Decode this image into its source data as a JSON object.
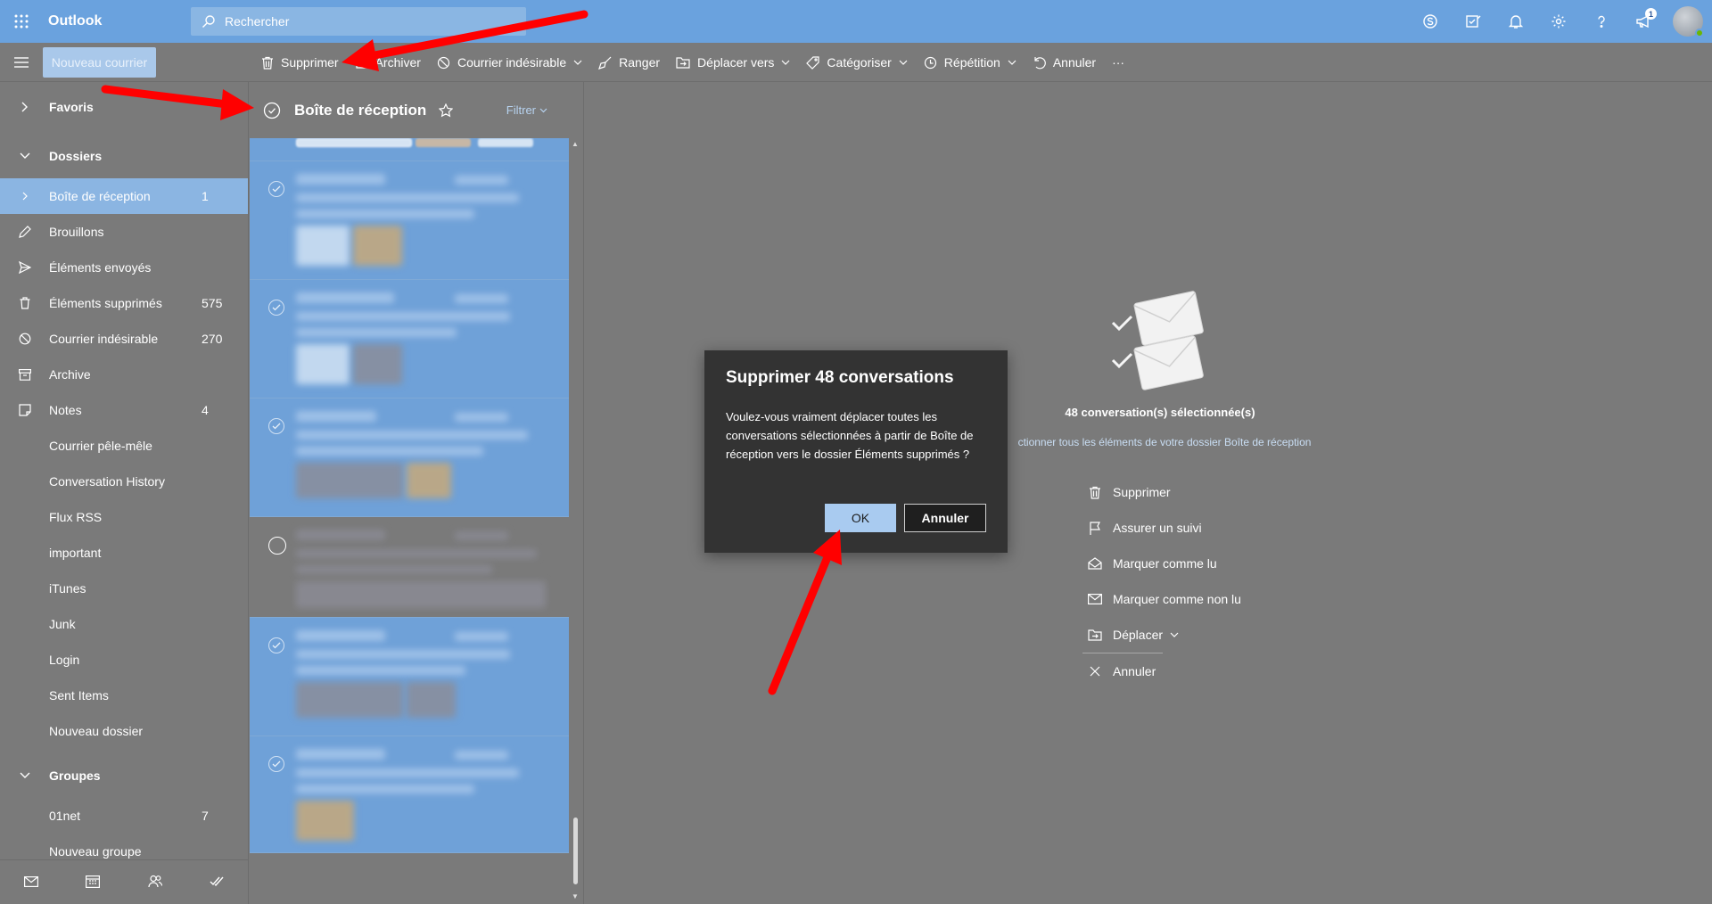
{
  "topbar": {
    "app_name": "Outlook",
    "search_placeholder": "Rechercher",
    "notification_count": "1"
  },
  "toolbar": {
    "new_mail": "Nouveau courrier",
    "commands": [
      {
        "label": "Supprimer",
        "icon": "trash-icon"
      },
      {
        "label": "Archiver",
        "icon": "archive-icon"
      },
      {
        "label": "Courrier indésirable",
        "icon": "block-icon"
      },
      {
        "label": "Ranger",
        "icon": "broom-icon"
      },
      {
        "label": "Déplacer vers",
        "icon": "move-folder-icon"
      },
      {
        "label": "Catégoriser",
        "icon": "tag-icon"
      },
      {
        "label": "Répétition",
        "icon": "clock-icon"
      },
      {
        "label": "Annuler",
        "icon": "undo-icon"
      }
    ],
    "more": "···"
  },
  "leftnav": {
    "favorites": "Favoris",
    "folders": "Dossiers",
    "items": [
      {
        "label": "Boîte de réception",
        "count": "1"
      },
      {
        "label": "Brouillons",
        "count": ""
      },
      {
        "label": "Éléments envoyés",
        "count": ""
      },
      {
        "label": "Éléments supprimés",
        "count": "575"
      },
      {
        "label": "Courrier indésirable",
        "count": "270"
      },
      {
        "label": "Archive",
        "count": ""
      },
      {
        "label": "Notes",
        "count": "4"
      },
      {
        "label": "Courrier pêle-mêle",
        "count": ""
      },
      {
        "label": "Conversation History",
        "count": ""
      },
      {
        "label": "Flux RSS",
        "count": ""
      },
      {
        "label": "important",
        "count": ""
      },
      {
        "label": "iTunes",
        "count": ""
      },
      {
        "label": "Junk",
        "count": ""
      },
      {
        "label": "Login",
        "count": ""
      },
      {
        "label": "Sent Items",
        "count": ""
      },
      {
        "label": "Nouveau dossier",
        "count": ""
      }
    ],
    "groups": "Groupes",
    "group_items": [
      {
        "label": "01net",
        "count": "7"
      },
      {
        "label": "Nouveau groupe",
        "count": ""
      }
    ]
  },
  "msglist": {
    "title": "Boîte de réception",
    "filter": "Filtrer"
  },
  "reading": {
    "selected_count": "48 conversation(s) sélectionnée(s)",
    "select_all_link": "ctionner tous les éléments de votre dossier Boîte de réception",
    "actions": [
      {
        "label": "Supprimer",
        "icon": "trash-icon"
      },
      {
        "label": "Assurer un suivi",
        "icon": "flag-icon"
      },
      {
        "label": "Marquer comme lu",
        "icon": "open-envelope-icon"
      },
      {
        "label": "Marquer comme non lu",
        "icon": "envelope-icon"
      },
      {
        "label": "Déplacer",
        "icon": "move-folder-icon"
      },
      {
        "label": "Annuler",
        "icon": "close-icon"
      }
    ]
  },
  "dialog": {
    "title": "Supprimer 48 conversations",
    "message": "Voulez-vous vraiment déplacer toutes les conversations sélectionnées à partir de Boîte de réception vers le dossier Éléments supprimés ?",
    "ok": "OK",
    "cancel": "Annuler"
  },
  "colors": {
    "topbar": "#6aa2de",
    "selection": "#6fa1d8",
    "overlay_gray": "#7a7a7a",
    "dialog_bg": "#333333",
    "annotation_arrow": "#ff0000"
  }
}
